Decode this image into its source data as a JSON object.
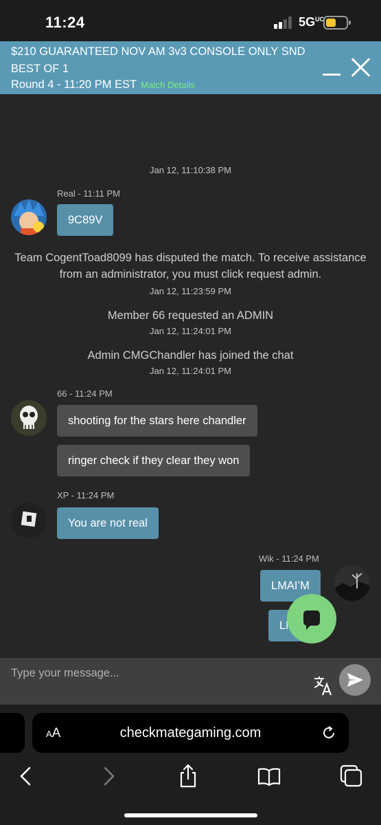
{
  "status_bar": {
    "time": "11:24",
    "network": "5G",
    "network_sup": "UC",
    "battery_level": 0.45
  },
  "match_header": {
    "title": "$210 GUARANTEED NOV AM 3v3 CONSOLE ONLY SND BEST OF 1",
    "round": "Round 4 - 11:20 PM EST",
    "details_link": "Match Details"
  },
  "chat": {
    "top_timestamp": "Jan 12, 11:10:38 PM",
    "messages": [
      {
        "sender": "Real - 11:11 PM",
        "avatar": "goku-avatar",
        "bubbles": [
          "9C89V"
        ]
      },
      {
        "sender": "66 - 11:24 PM",
        "avatar": "skull-avatar",
        "bubbles": [
          "shooting for the stars here chandler",
          "ringer check if they clear they won"
        ]
      },
      {
        "sender": "XP - 11:24 PM",
        "avatar": "dark-avatar",
        "bubbles": [
          "You are not real"
        ]
      },
      {
        "sender": "Wik - 11:24 PM",
        "avatar": "landscape-avatar",
        "bubbles": [
          "LMAI’M",
          "LM"
        ]
      }
    ],
    "system_messages": [
      {
        "text": "Team CogentToad8099 has disputed the match. To receive assistance from an administrator, you must click request admin.",
        "time": "Jan 12, 11:23:59 PM"
      },
      {
        "text": "Member 66 requested an ADMIN",
        "time": "Jan 12, 11:24:01 PM"
      },
      {
        "text": "Admin CMGChandler has joined the chat",
        "time": "Jan 12, 11:24:01 PM"
      }
    ]
  },
  "input": {
    "placeholder": "Type your message..."
  },
  "browser": {
    "aa_small": "A",
    "aa_large": "A",
    "url": "checkmategaming.com"
  },
  "colors": {
    "header": "#5a9ab5",
    "bubble_blue": "#5790a8",
    "bubble_gray": "#4e4e4e",
    "fab": "#7fd47f",
    "link": "#7cf07c"
  }
}
